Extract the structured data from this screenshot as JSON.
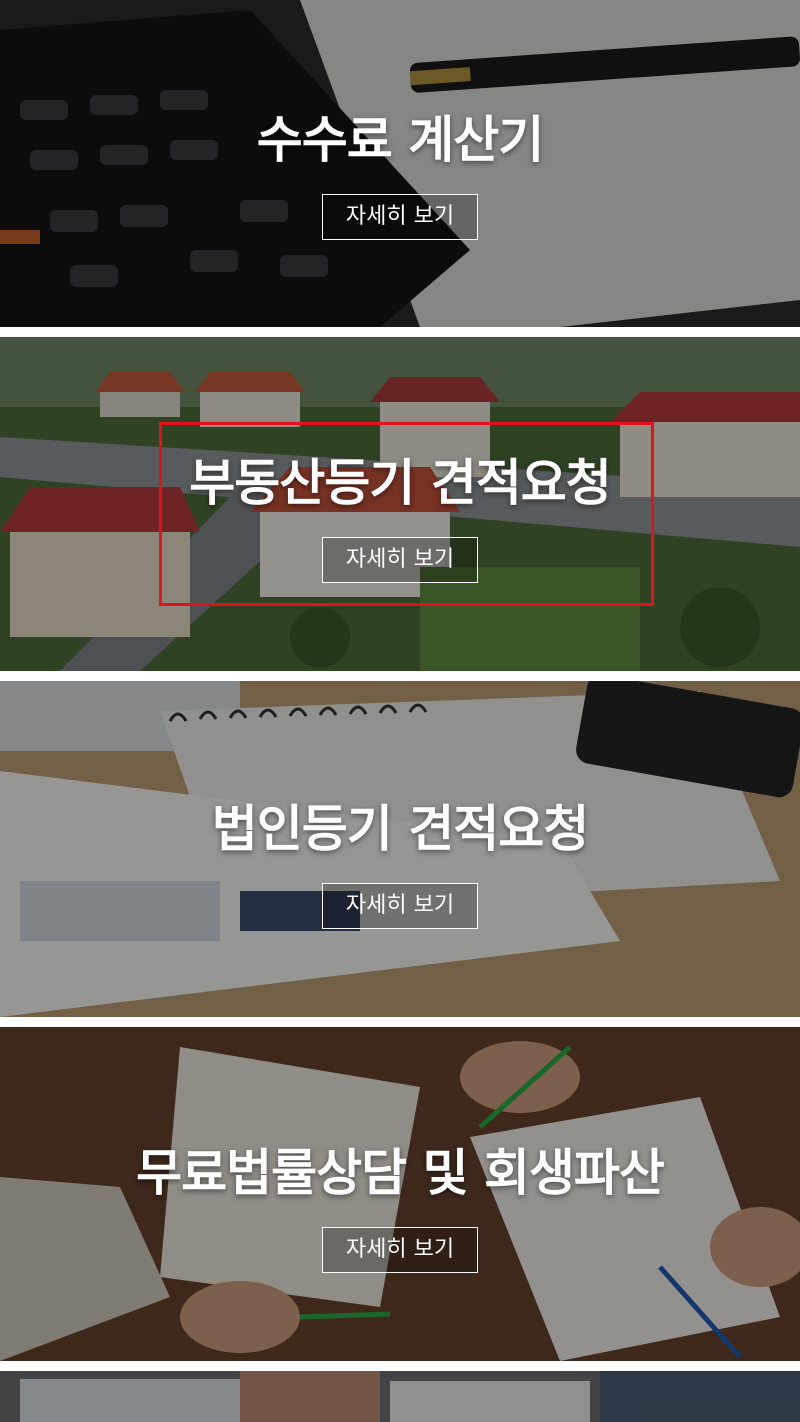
{
  "cards": [
    {
      "title": "수수료 계산기",
      "button": "자세히 보기",
      "image": "calculator-and-pen-photo"
    },
    {
      "title": "부동산등기 견적요청",
      "button": "자세히 보기",
      "image": "aerial-houses-photo"
    },
    {
      "title": "법인등기 견적요청",
      "button": "자세히 보기",
      "image": "notebook-and-papers-photo"
    },
    {
      "title": "무료법률상담 및 회생파산",
      "button": "자세히 보기",
      "image": "hands-writing-documents-photo"
    }
  ],
  "colors": {
    "highlight": "#e3101e",
    "text": "#ffffff"
  }
}
